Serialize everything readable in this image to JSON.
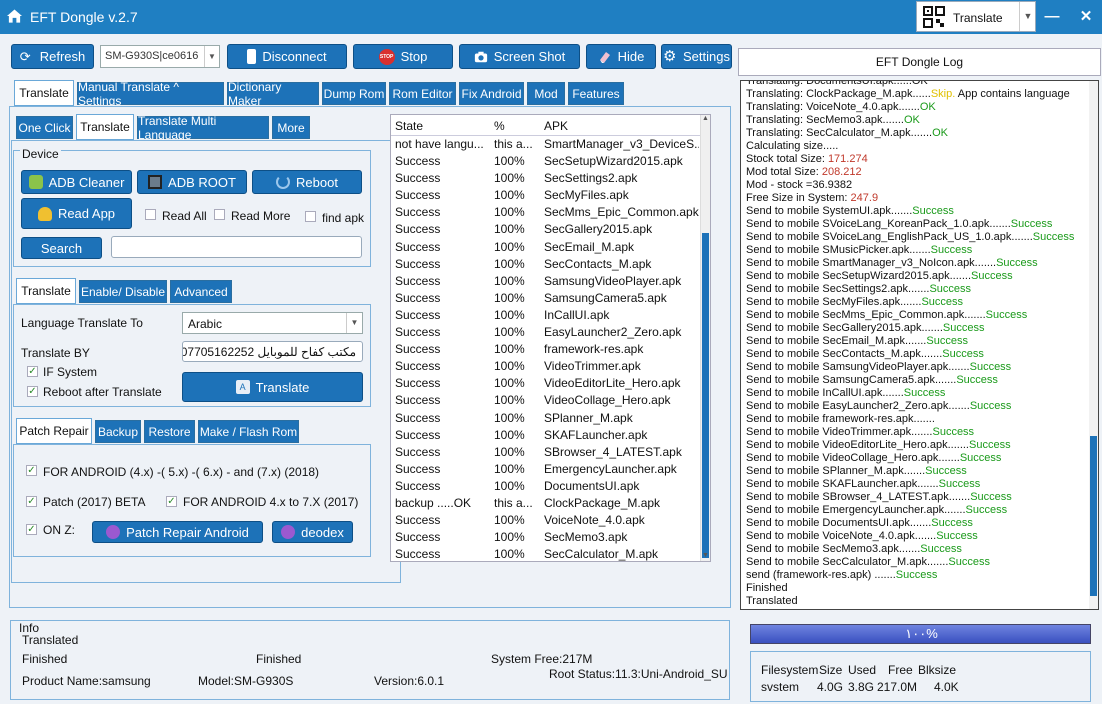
{
  "titlebar": {
    "title": "EFT Dongle  v.2.7",
    "translate_label": "Translate"
  },
  "toolbar": {
    "refresh": "Refresh",
    "device_value": "SM-G930S|ce0616",
    "disconnect": "Disconnect",
    "stop": "Stop",
    "screenshot": "Screen Shot",
    "hide": "Hide",
    "settings": "Settings"
  },
  "main_tabs": [
    "Translate",
    "Manual Translate ^ Settings",
    "Dictionary Maker",
    "Dump Rom",
    "Rom Editor",
    "Fix Android",
    "Mod",
    "Features"
  ],
  "sub_tabs": [
    "One Click",
    "Translate",
    "Translate Multi Language",
    "More"
  ],
  "device": {
    "title": "Device",
    "adb_cleaner": "ADB Cleaner",
    "adb_root": "ADB ROOT",
    "reboot": "Reboot",
    "read_app": "Read App",
    "read_all": "Read All",
    "read_more": "Read More",
    "find_apk": "find apk",
    "search": "Search",
    "search_value": ""
  },
  "translate_tabs": [
    "Translate",
    "Enable/ Disable",
    "Advanced"
  ],
  "translate": {
    "lang_label": "Language Translate To",
    "lang_value": "Arabic",
    "by_label": "Translate BY",
    "by_value": "مكتب كفاح للموبايل 07705162252",
    "if_system": "IF System",
    "reboot_after": "Reboot after Translate",
    "button": "Translate"
  },
  "patch_tabs": [
    "Patch Repair",
    "Backup",
    "Restore",
    "Make / Flash Rom"
  ],
  "patch": {
    "opt1": "FOR  ANDROID (4.x)  -( 5.x) -( 6.x) - and  (7.x)  (2018)",
    "opt2": "Patch   (2017) BETA",
    "opt3": "FOR  ANDROID 4.x to 7.X (2017)",
    "opt4": "ON Z:",
    "patch_button": "Patch Repair Android",
    "deodex": "deodex"
  },
  "table": {
    "headers": [
      "State",
      "%",
      "APK"
    ],
    "rows": [
      [
        "not have langu...",
        "this a...",
        "SmartManager_v3_DeviceS..."
      ],
      [
        "Success",
        "100%",
        "SecSetupWizard2015.apk"
      ],
      [
        "Success",
        "100%",
        "SecSettings2.apk"
      ],
      [
        "Success",
        "100%",
        "SecMyFiles.apk"
      ],
      [
        "Success",
        "100%",
        "SecMms_Epic_Common.apk"
      ],
      [
        "Success",
        "100%",
        "SecGallery2015.apk"
      ],
      [
        "Success",
        "100%",
        "SecEmail_M.apk"
      ],
      [
        "Success",
        "100%",
        "SecContacts_M.apk"
      ],
      [
        "Success",
        "100%",
        "SamsungVideoPlayer.apk"
      ],
      [
        "Success",
        "100%",
        "SamsungCamera5.apk"
      ],
      [
        "Success",
        "100%",
        "InCallUI.apk"
      ],
      [
        "Success",
        "100%",
        "EasyLauncher2_Zero.apk"
      ],
      [
        "Success",
        "100%",
        "framework-res.apk"
      ],
      [
        "Success",
        "100%",
        "VideoTrimmer.apk"
      ],
      [
        "Success",
        "100%",
        "VideoEditorLite_Hero.apk"
      ],
      [
        "Success",
        "100%",
        "VideoCollage_Hero.apk"
      ],
      [
        "Success",
        "100%",
        "SPlanner_M.apk"
      ],
      [
        "Success",
        "100%",
        "SKAFLauncher.apk"
      ],
      [
        "Success",
        "100%",
        "SBrowser_4_LATEST.apk"
      ],
      [
        "Success",
        "100%",
        "EmergencyLauncher.apk"
      ],
      [
        "Success",
        "100%",
        "DocumentsUI.apk"
      ],
      [
        "backup .....OK",
        "this a...",
        "ClockPackage_M.apk"
      ],
      [
        "Success",
        "100%",
        "VoiceNote_4.0.apk"
      ],
      [
        "Success",
        "100%",
        "SecMemo3.apk"
      ],
      [
        "Success",
        "100%",
        "SecCalculator_M.apk"
      ]
    ]
  },
  "log": {
    "title": "EFT Dongle Log",
    "lines": [
      {
        "t": "Translating: DocumentsUI.apk......OK",
        "s": ""
      },
      {
        "t": "Translating: ClockPackage_M.apk......",
        "s": "Skip.",
        "e": " App contains language",
        "k": "warn"
      },
      {
        "t": "Translating: VoiceNote_4.0.apk.......",
        "s": "OK",
        "k": "ok"
      },
      {
        "t": "Translating: SecMemo3.apk.......",
        "s": "OK",
        "k": "ok"
      },
      {
        "t": "Translating: SecCalculator_M.apk.......",
        "s": "OK",
        "k": "ok"
      },
      {
        "t": "Calculating size.....",
        "s": ""
      },
      {
        "t": "Stock total Size: ",
        "s": "171.274",
        "k": "red"
      },
      {
        "t": "Mod total Size: ",
        "s": "208.212",
        "k": "red"
      },
      {
        "t": "Mod - stock =36.9382",
        "s": ""
      },
      {
        "t": "Free Size in System: ",
        "s": "247.9",
        "k": "red"
      },
      {
        "t": "Send to mobile SystemUI.apk.......",
        "s": "Success",
        "k": "ok"
      },
      {
        "t": "Send to mobile SVoiceLang_KoreanPack_1.0.apk.......",
        "s": "Success",
        "k": "ok"
      },
      {
        "t": "Send to mobile SVoiceLang_EnglishPack_US_1.0.apk.......",
        "s": "Success",
        "k": "ok"
      },
      {
        "t": "Send to mobile SMusicPicker.apk.......",
        "s": "Success",
        "k": "ok"
      },
      {
        "t": "Send to mobile SmartManager_v3_NoIcon.apk.......",
        "s": "Success",
        "k": "ok"
      },
      {
        "t": "Send to mobile SecSetupWizard2015.apk.......",
        "s": "Success",
        "k": "ok"
      },
      {
        "t": "Send to mobile SecSettings2.apk.......",
        "s": "Success",
        "k": "ok"
      },
      {
        "t": "Send to mobile SecMyFiles.apk.......",
        "s": "Success",
        "k": "ok"
      },
      {
        "t": "Send to mobile SecMms_Epic_Common.apk.......",
        "s": "Success",
        "k": "ok"
      },
      {
        "t": "Send to mobile SecGallery2015.apk.......",
        "s": "Success",
        "k": "ok"
      },
      {
        "t": "Send to mobile SecEmail_M.apk.......",
        "s": "Success",
        "k": "ok"
      },
      {
        "t": "Send to mobile SecContacts_M.apk.......",
        "s": "Success",
        "k": "ok"
      },
      {
        "t": "Send to mobile SamsungVideoPlayer.apk.......",
        "s": "Success",
        "k": "ok"
      },
      {
        "t": "Send to mobile SamsungCamera5.apk.......",
        "s": "Success",
        "k": "ok"
      },
      {
        "t": "Send to mobile InCallUI.apk.......",
        "s": "Success",
        "k": "ok"
      },
      {
        "t": "Send to mobile EasyLauncher2_Zero.apk.......",
        "s": "Success",
        "k": "ok"
      },
      {
        "t": "Send to mobile framework-res.apk.......",
        "s": ""
      },
      {
        "t": "Send to mobile VideoTrimmer.apk.......",
        "s": "Success",
        "k": "ok"
      },
      {
        "t": "Send to mobile VideoEditorLite_Hero.apk.......",
        "s": "Success",
        "k": "ok"
      },
      {
        "t": "Send to mobile VideoCollage_Hero.apk.......",
        "s": "Success",
        "k": "ok"
      },
      {
        "t": "Send to mobile SPlanner_M.apk.......",
        "s": "Success",
        "k": "ok"
      },
      {
        "t": "Send to mobile SKAFLauncher.apk.......",
        "s": "Success",
        "k": "ok"
      },
      {
        "t": "Send to mobile SBrowser_4_LATEST.apk.......",
        "s": "Success",
        "k": "ok"
      },
      {
        "t": "Send to mobile EmergencyLauncher.apk.......",
        "s": "Success",
        "k": "ok"
      },
      {
        "t": "Send to mobile DocumentsUI.apk.......",
        "s": "Success",
        "k": "ok"
      },
      {
        "t": "Send to mobile VoiceNote_4.0.apk.......",
        "s": "Success",
        "k": "ok"
      },
      {
        "t": "Send to mobile SecMemo3.apk.......",
        "s": "Success",
        "k": "ok"
      },
      {
        "t": "Send to mobile SecCalculator_M.apk.......",
        "s": "Success",
        "k": "ok"
      },
      {
        "t": "send (framework-res.apk) .......",
        "s": "Success",
        "k": "ok"
      },
      {
        "t": "Finished",
        "s": ""
      },
      {
        "t": "Translated",
        "s": ""
      }
    ]
  },
  "progress": {
    "label": "١٠٠%",
    "value": 100
  },
  "filesystem": {
    "headers": [
      "Filesystem",
      "Size",
      "Used",
      "Free",
      "Blksize"
    ],
    "values": [
      "svstem",
      "4.0G",
      "3.8G",
      "217.0M",
      "4.0K"
    ]
  },
  "info": {
    "title": "Info",
    "status1": "Translated",
    "status2": "Finished",
    "status3": "Finished",
    "system_free": "System Free:217M",
    "product": "Product Name:samsung",
    "model": "Model:SM-G930S",
    "version": "Version:6.0.1",
    "root": "Root Status:11.3:Uni-Android_SU"
  },
  "colors": {
    "accent": "#1d72b8",
    "titlebar": "#1f7fc2",
    "ok": "#1a9a1a",
    "red": "#c0392b"
  }
}
